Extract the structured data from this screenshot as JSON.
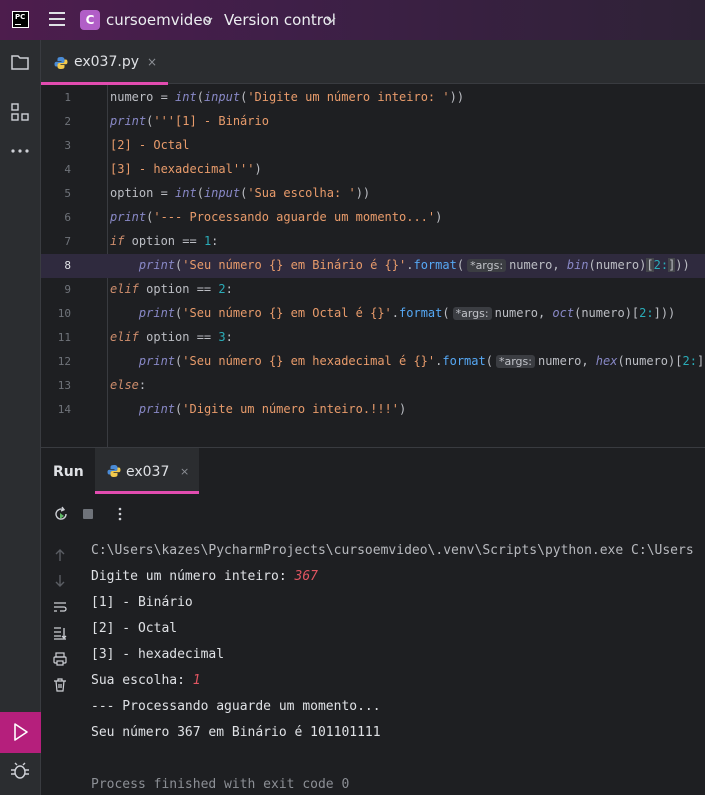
{
  "titlebar": {
    "logo_text": "PC",
    "project_badge": "C",
    "project_name": "cursoemvideo",
    "vcs_label": "Version control"
  },
  "colors": {
    "accent": "#e24cb0",
    "run_active": "#b51f7c",
    "titlebar": "#4d1d4d",
    "project_badge": "#b15ec7"
  },
  "editor": {
    "tab": {
      "label": "ex037.py",
      "close": "×",
      "icon": "python-file-icon"
    },
    "current_line": 8,
    "lines": [
      {
        "n": "1"
      },
      {
        "n": "2"
      },
      {
        "n": "3"
      },
      {
        "n": "4"
      },
      {
        "n": "5"
      },
      {
        "n": "6"
      },
      {
        "n": "7"
      },
      {
        "n": "8"
      },
      {
        "n": "9"
      },
      {
        "n": "10"
      },
      {
        "n": "11"
      },
      {
        "n": "12"
      },
      {
        "n": "13"
      },
      {
        "n": "14"
      }
    ],
    "code": {
      "l1_var": "numero = ",
      "l1_int": "int",
      "l1_input": "input",
      "l1_str": "'Digite um número inteiro: '",
      "l2_print": "print",
      "l2_str": "'''[1] - Binário",
      "l3_str": "[2] - Octal",
      "l4_str": "[3] - hexadecimal'''",
      "l5_var": "option = ",
      "l5_int": "int",
      "l5_input": "input",
      "l5_str": "'Sua escolha: '",
      "l6_print": "print",
      "l6_str": "'--- Processando aguarde um momento...'",
      "l7_if": "if",
      "l7_cond": " option == ",
      "l7_num": "1",
      "l8_print": "print",
      "l8_str": "'Seu número {} em Binário é {}'",
      "l8_fmt": "format",
      "hint_args": "*args:",
      "l8_rest": "numero, ",
      "l8_fn": "bin",
      "l8_arg": "numero",
      "l8_slice": "2:",
      "l9_elif": "elif",
      "l9_cond": " option == ",
      "l9_num": "2",
      "l10_print": "print",
      "l10_str": "'Seu número {} em Octal é {}'",
      "l10_fmt": "format",
      "l10_rest": "numero, ",
      "l10_fn": "oct",
      "l10_arg": "numero",
      "l10_slice": "2:",
      "l11_elif": "elif",
      "l11_cond": " option == ",
      "l11_num": "3",
      "l12_print": "print",
      "l12_str": "'Seu número {} em hexadecimal é {}'",
      "l12_fmt": "format",
      "l12_rest": "numero, ",
      "l12_fn": "hex",
      "l12_arg": "numero",
      "l12_slice": "2:",
      "l13_else": "else",
      "l14_print": "print",
      "l14_str": "'Digite um número inteiro.!!!'"
    }
  },
  "run_panel": {
    "title": "Run",
    "tab_label": "ex037",
    "tab_close": "×",
    "console": {
      "cmd": "C:\\Users\\kazes\\PycharmProjects\\cursoemvideo\\.venv\\Scripts\\python.exe C:\\Users",
      "prompt1": "Digite um número inteiro: ",
      "input1": "367",
      "menu1": "[1] - Binário",
      "menu2": "[2] - Octal",
      "menu3": "[3] - hexadecimal",
      "prompt2": "Sua escolha: ",
      "input2": "1",
      "processing": "--- Processando aguarde um momento...",
      "result": "Seu número 367 em Binário é 101101111",
      "finish": "Process finished with exit code 0"
    }
  }
}
